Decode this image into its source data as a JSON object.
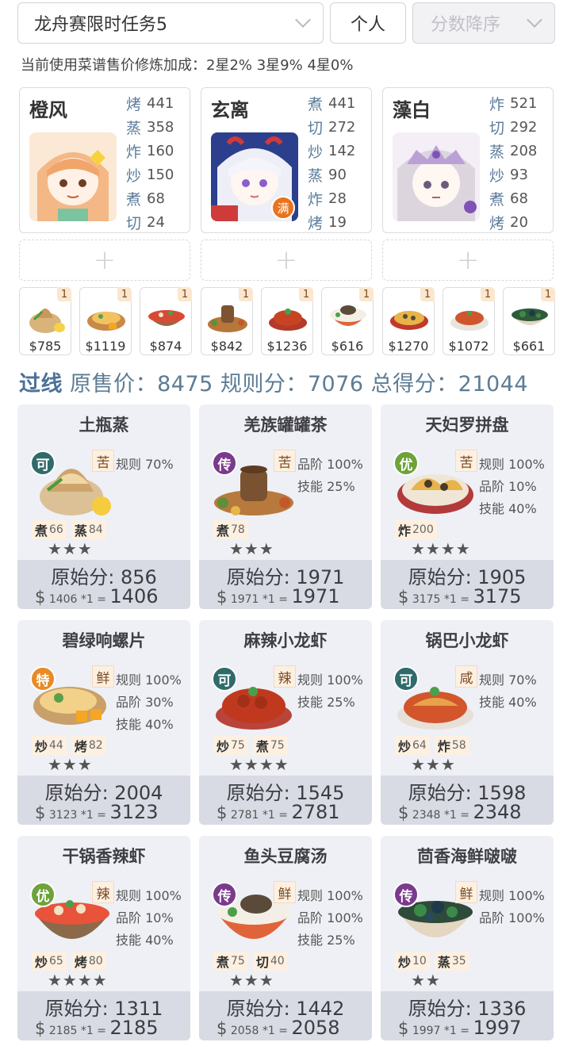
{
  "header": {
    "task": "龙舟赛限时任务5",
    "mode": "个人",
    "sort": "分数降序"
  },
  "bonus_text": "当前使用菜谱售价修炼加成：2星2% 3星9% 4星0%",
  "chefs": [
    {
      "name": "橙风",
      "skills": [
        {
          "k": "烤",
          "v": "441"
        },
        {
          "k": "蒸",
          "v": "358"
        },
        {
          "k": "炸",
          "v": "160"
        },
        {
          "k": "炒",
          "v": "150"
        },
        {
          "k": "煮",
          "v": "68"
        },
        {
          "k": "切",
          "v": "24"
        }
      ]
    },
    {
      "name": "玄离",
      "badge": "满",
      "skills": [
        {
          "k": "煮",
          "v": "441"
        },
        {
          "k": "切",
          "v": "272"
        },
        {
          "k": "炒",
          "v": "142"
        },
        {
          "k": "蒸",
          "v": "90"
        },
        {
          "k": "炸",
          "v": "28"
        },
        {
          "k": "烤",
          "v": "19"
        }
      ]
    },
    {
      "name": "藻白",
      "skills": [
        {
          "k": "炸",
          "v": "521"
        },
        {
          "k": "切",
          "v": "292"
        },
        {
          "k": "蒸",
          "v": "208"
        },
        {
          "k": "炒",
          "v": "93"
        },
        {
          "k": "煮",
          "v": "68"
        },
        {
          "k": "烤",
          "v": "20"
        }
      ]
    }
  ],
  "add_symbol": "+",
  "thumbs": [
    {
      "q": "1",
      "price": "$785"
    },
    {
      "q": "1",
      "price": "$1119"
    },
    {
      "q": "1",
      "price": "$874"
    },
    {
      "q": "1",
      "price": "$842"
    },
    {
      "q": "1",
      "price": "$1236"
    },
    {
      "q": "1",
      "price": "$616"
    },
    {
      "q": "1",
      "price": "$1270"
    },
    {
      "q": "1",
      "price": "$1072"
    },
    {
      "q": "1",
      "price": "$661"
    }
  ],
  "totals": {
    "pass": "过线",
    "text": " 原售价：8475 规则分：7076 总得分：21044"
  },
  "dishes": [
    {
      "name": "土瓶蒸",
      "rarity": "可",
      "flavor": "苦",
      "mods": [
        "规则 70%"
      ],
      "req": [
        {
          "k": "煮",
          "v": "66"
        },
        {
          "k": "蒸",
          "v": "84"
        }
      ],
      "stars": "★★★",
      "orig": "原始分: 856",
      "price": "1406 *1 =",
      "total": "1406"
    },
    {
      "name": "羌族罐罐茶",
      "rarity": "传",
      "flavor": "苦",
      "mods": [
        "品阶 100%",
        "技能 25%"
      ],
      "req": [
        {
          "k": "煮",
          "v": "78"
        }
      ],
      "stars": "★★★",
      "orig": "原始分: 1971",
      "price": "1971 *1 =",
      "total": "1971"
    },
    {
      "name": "天妇罗拼盘",
      "rarity": "优",
      "flavor": "苦",
      "mods": [
        "规则 100%",
        "品阶 10%",
        "技能 40%"
      ],
      "req": [
        {
          "k": "炸",
          "v": "200"
        }
      ],
      "stars": "★★★★",
      "orig": "原始分: 1905",
      "price": "3175 *1 =",
      "total": "3175"
    },
    {
      "name": "碧绿响螺片",
      "rarity": "特",
      "flavor": "鲜",
      "mods": [
        "规则 100%",
        "品阶 30%",
        "技能 40%"
      ],
      "req": [
        {
          "k": "炒",
          "v": "44"
        },
        {
          "k": "烤",
          "v": "82"
        }
      ],
      "stars": "★★★",
      "orig": "原始分: 2004",
      "price": "3123 *1 =",
      "total": "3123"
    },
    {
      "name": "麻辣小龙虾",
      "rarity": "可",
      "flavor": "辣",
      "mods": [
        "规则 100%",
        "技能 25%"
      ],
      "req": [
        {
          "k": "炒",
          "v": "75"
        },
        {
          "k": "煮",
          "v": "75"
        }
      ],
      "stars": "★★★★",
      "orig": "原始分: 1545",
      "price": "2781 *1 =",
      "total": "2781"
    },
    {
      "name": "锅巴小龙虾",
      "rarity": "可",
      "flavor": "咸",
      "mods": [
        "规则 70%",
        "技能 40%"
      ],
      "req": [
        {
          "k": "炒",
          "v": "64"
        },
        {
          "k": "炸",
          "v": "58"
        }
      ],
      "stars": "★★★",
      "orig": "原始分: 1598",
      "price": "2348 *1 =",
      "total": "2348"
    },
    {
      "name": "干锅香辣虾",
      "rarity": "优",
      "flavor": "辣",
      "mods": [
        "规则 100%",
        "品阶 10%",
        "技能 40%"
      ],
      "req": [
        {
          "k": "炒",
          "v": "65"
        },
        {
          "k": "烤",
          "v": "80"
        }
      ],
      "stars": "★★★★",
      "orig": "原始分: 1311",
      "price": "2185 *1 =",
      "total": "2185"
    },
    {
      "name": "鱼头豆腐汤",
      "rarity": "传",
      "flavor": "鲜",
      "mods": [
        "规则 100%",
        "品阶 100%",
        "技能 25%"
      ],
      "req": [
        {
          "k": "煮",
          "v": "75"
        },
        {
          "k": "切",
          "v": "40"
        }
      ],
      "stars": "★★★",
      "orig": "原始分: 1442",
      "price": "2058 *1 =",
      "total": "2058"
    },
    {
      "name": "茴香海鲜啵啵",
      "rarity": "传",
      "flavor": "鲜",
      "mods": [
        "规则 100%",
        "品阶 100%"
      ],
      "req": [
        {
          "k": "炒",
          "v": "10"
        },
        {
          "k": "蒸",
          "v": "35"
        }
      ],
      "stars": "★★",
      "orig": "原始分: 1336",
      "price": "1997 *1 =",
      "total": "1997"
    }
  ],
  "dollar": "$",
  "colors": {
    "rarity_ke": "#2f6b6a",
    "rarity_chuan": "#7a3b8c",
    "rarity_you": "#6ea23a",
    "rarity_te": "#e98a25",
    "accent": "#4c7199"
  }
}
